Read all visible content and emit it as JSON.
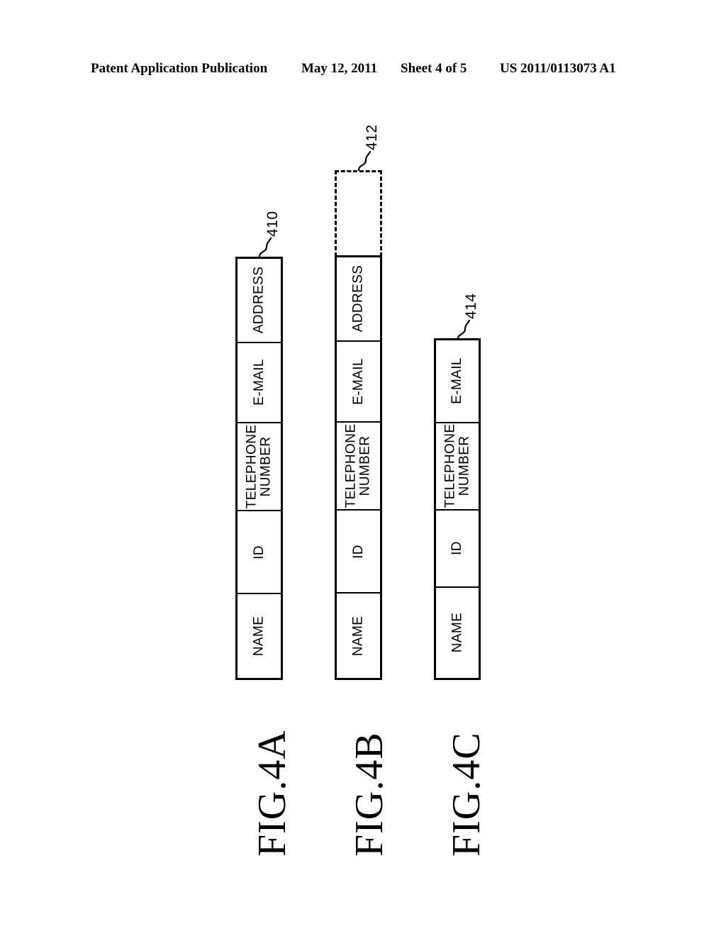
{
  "header": {
    "publication": "Patent Application Publication",
    "date": "May 12, 2011",
    "sheet": "Sheet 4 of 5",
    "patent_number": "US 2011/0113073 A1"
  },
  "figures": [
    {
      "caption": "FIG.4A",
      "reference": "410",
      "cells": [
        {
          "label_line1": "ADDRESS",
          "label_line2": ""
        },
        {
          "label_line1": "E-MAIL",
          "label_line2": ""
        },
        {
          "label_line1": "TELEPHONE",
          "label_line2": "NUMBER"
        },
        {
          "label_line1": "ID",
          "label_line2": ""
        },
        {
          "label_line1": "NAME",
          "label_line2": ""
        }
      ],
      "has_dashed_extension": false
    },
    {
      "caption": "FIG.4B",
      "reference": "412",
      "cells": [
        {
          "label_line1": "ADDRESS",
          "label_line2": ""
        },
        {
          "label_line1": "E-MAIL",
          "label_line2": ""
        },
        {
          "label_line1": "TELEPHONE",
          "label_line2": "NUMBER"
        },
        {
          "label_line1": "ID",
          "label_line2": ""
        },
        {
          "label_line1": "NAME",
          "label_line2": ""
        }
      ],
      "has_dashed_extension": true,
      "dashed_extension_label": ""
    },
    {
      "caption": "FIG.4C",
      "reference": "414",
      "cells": [
        {
          "label_line1": "E-MAIL",
          "label_line2": ""
        },
        {
          "label_line1": "TELEPHONE",
          "label_line2": "NUMBER"
        },
        {
          "label_line1": "ID",
          "label_line2": ""
        },
        {
          "label_line1": "NAME",
          "label_line2": ""
        }
      ],
      "has_dashed_extension": false
    }
  ],
  "colors": {
    "ink": "#000000",
    "paper": "#ffffff"
  }
}
